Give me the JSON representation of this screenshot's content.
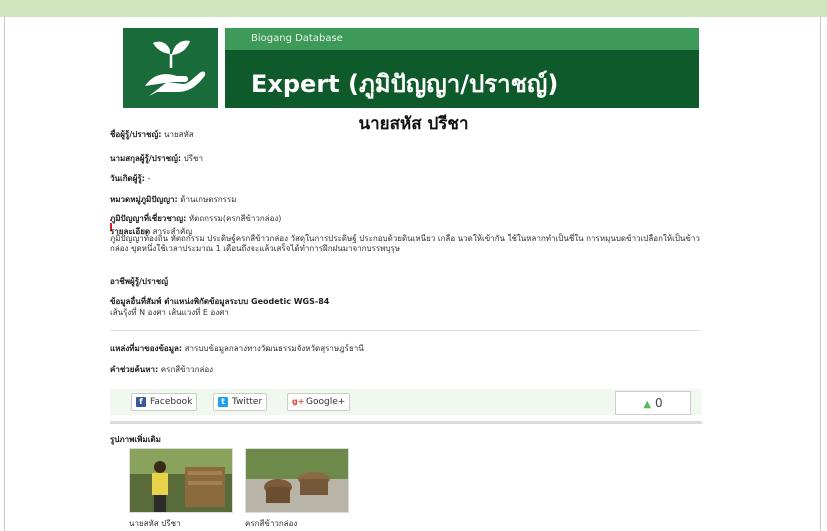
{
  "site": {
    "db_label": "Biogang Database",
    "heading": "Expert (ภูมิปัญญา/ปราชญ์)"
  },
  "person_title": "นายสหัส ปรีชา",
  "fields": {
    "name_label": "ชื่อผู้รู้/ปราชญ์:",
    "name_value": "นายสหัส",
    "surname_label": "นามสกุลผู้รู้/ปราชญ์:",
    "surname_value": "ปรีชา",
    "birth_label": "วันเกิดผู้รู้:",
    "birth_value": "-",
    "category_label": "หมวดหมู่ภูมิปัญญา:",
    "category_value": "ด้านเกษตรกรรม",
    "wisdom_label": "ภูมิปัญญาที่เชี่ยวชาญ:",
    "wisdom_value": "หัตถกรรม(ครกสีข้าวกล่อง)",
    "detail_label": "รายละเอียด",
    "detail_sub": "สาระสำคัญ",
    "detail_text": "ภูมิปัญญาท้องถิ่น หัตถกรรม ประดิษฐ์ครกสีข้าวกล่อง วัสดุในการประดิษฐ์ ประกอบด้วยดินเหนียว เกลือ นวดให้เข้ากัน ใช้ในหลากทำเป็นชี่ใน การหมุนบดข้าวเปลือกให้เป็นข้าวกล่อง ขุดหนึ่งใช้เวลาประมาณ 1 เดือนถึงจะแล้วเสร็จได้ทำการฝึกฝนมาจากบรรพบุรุษ",
    "occupation_label": "อาชีพผู้รู้/ปราชญ์",
    "geo_label": "ข้อมูลอื่นที่สัมพ์ ตำแหน่งพิกัดข้อมูลระบบ Geodetic WGS-84",
    "geo_value": "เส้นรุ้งที่ N องศา เส้นแวงที่ E องศา",
    "source_label": "แหล่งที่มาของข้อมูล:",
    "source_value": "สารบบข้อมูลกลางทางวัฒนธรรมจังหวัดสุราษฎร์ธานี",
    "keyword_label": "คำช่วยค้นหา:",
    "keyword_value": "ครกสีข้าวกล่อง"
  },
  "share": {
    "facebook": "Facebook",
    "twitter": "Twitter",
    "google": "Google+",
    "like_count": "0"
  },
  "photos": {
    "heading": "รูปภาพเพิ่มเติม",
    "items": [
      {
        "caption": "นายสหัส ปรีชา"
      },
      {
        "caption": "ครกสีข้าวกล่อง"
      }
    ]
  },
  "colors": {
    "brand_dark": "#0f5a2a",
    "brand_light": "#3d9a58",
    "top_bar": "#cfe5bd"
  }
}
